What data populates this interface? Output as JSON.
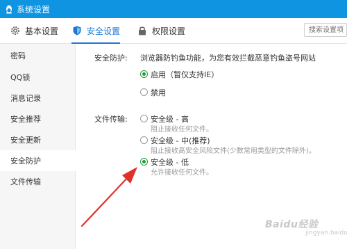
{
  "window": {
    "title": "系统设置"
  },
  "tabs": [
    {
      "label": "基本设置",
      "icon": "gear-icon"
    },
    {
      "label": "安全设置",
      "icon": "shield-icon",
      "active": true
    },
    {
      "label": "权限设置",
      "icon": "lock-icon"
    }
  ],
  "search": {
    "placeholder": "搜索设置项"
  },
  "sidebar": {
    "items": [
      {
        "label": "密码"
      },
      {
        "label": "QQ锁"
      },
      {
        "label": "消息记录"
      },
      {
        "label": "安全推荐"
      },
      {
        "label": "安全更新"
      },
      {
        "label": "安全防护",
        "active": true
      },
      {
        "label": "文件传输"
      }
    ]
  },
  "security": {
    "label": "安全防护:",
    "description": "浏览器防钓鱼功能，为您有效拦截恶意钓鱼盗号网站",
    "options": [
      {
        "label": "启用（暂仅支持IE）",
        "checked": true
      },
      {
        "label": "禁用",
        "checked": false
      }
    ]
  },
  "file_transfer": {
    "label": "文件传输:",
    "options": [
      {
        "label": "安全级 - 高",
        "desc": "阻止接收任何文件。",
        "checked": false
      },
      {
        "label": "安全级 - 中(推荐)",
        "desc": "阻止接收高安全风险文件(少数常用类型的文件除外)。",
        "checked": false
      },
      {
        "label": "安全级 - 低",
        "desc": "允许接收任何文件。",
        "checked": true
      }
    ]
  },
  "watermark": {
    "text": "Baidu经验",
    "sub": "jingyan.baidu.com"
  },
  "colors": {
    "titlebar": "#0f94e2",
    "accent": "#1a78d2",
    "radio_checked": "#1f9e3a",
    "arrow": "#e0322b"
  }
}
